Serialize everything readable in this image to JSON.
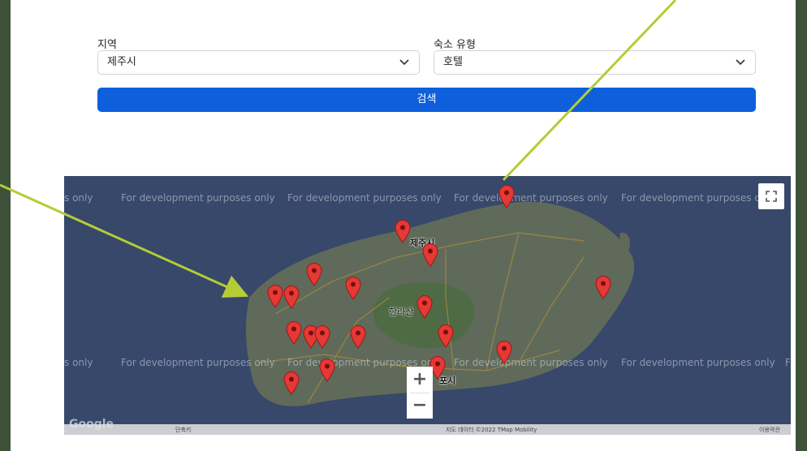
{
  "filters": {
    "region_label": "지역",
    "region_value": "제주시",
    "type_label": "숙소 유형",
    "type_value": "호텔",
    "search_label": "검색"
  },
  "map": {
    "watermark": "For development purposes only",
    "watermark_left_fragment": "s only",
    "watermark_right_fragment": "F",
    "city_jeju": "제주시",
    "city_hallasan": "한라산",
    "city_seogwipo": "포시",
    "zoom_in": "+",
    "zoom_out": "−",
    "footer_shortcuts": "단축키",
    "footer_data": "지도 데이터 ©2022 TMap Mobility",
    "footer_terms": "이용약관",
    "google_logo": "Google",
    "marker_color": "#e53935",
    "fullscreen_icon": "fullscreen-icon"
  },
  "colors": {
    "primary_button": "#0d5fdc",
    "annotation_arrow": "#b5cc35",
    "frame_background": "#3d5238"
  }
}
